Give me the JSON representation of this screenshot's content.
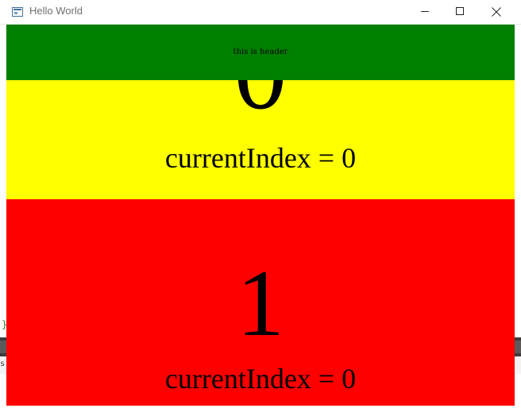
{
  "window": {
    "title": "Hello World"
  },
  "header": {
    "text": "this is header"
  },
  "pages": [
    {
      "number": "0",
      "index_label": "currentIndex = 0",
      "color": "#ffff00"
    },
    {
      "number": "1",
      "index_label": "currentIndex = 0",
      "color": "#ff0000"
    }
  ],
  "colors": {
    "header": "#008000",
    "titlebar": "#ffffff"
  },
  "background": {
    "bracket": "}",
    "strip_text": "s"
  }
}
